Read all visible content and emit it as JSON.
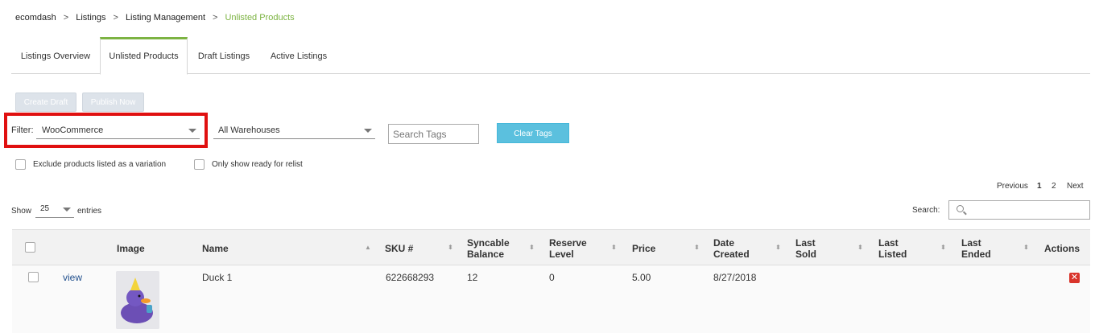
{
  "breadcrumb": {
    "items": [
      "ecomdash",
      "Listings",
      "Listing Management",
      "Unlisted Products"
    ],
    "separator": ">"
  },
  "tabs": [
    {
      "label": "Listings Overview",
      "active": false
    },
    {
      "label": "Unlisted Products",
      "active": true
    },
    {
      "label": "Draft Listings",
      "active": false
    },
    {
      "label": "Active Listings",
      "active": false
    }
  ],
  "actions": {
    "create_draft": "Create Draft",
    "publish_now": "Publish Now"
  },
  "filters": {
    "filter_label": "Filter:",
    "channel_value": "WooCommerce",
    "warehouse_value": "All Warehouses",
    "search_tags_placeholder": "Search Tags",
    "clear_tags": "Clear Tags",
    "exclude_variation_label": "Exclude products listed as a variation",
    "ready_relist_label": "Only show ready for relist"
  },
  "pagination": {
    "previous": "Previous",
    "page1": "1",
    "page2": "2",
    "next": "Next"
  },
  "table_controls": {
    "show_label": "Show",
    "entries_value": "25",
    "entries_label": "entries",
    "search_label": "Search:"
  },
  "table": {
    "headers": {
      "image": "Image",
      "name": "Name",
      "sku": "SKU #",
      "syncable_balance": "Syncable Balance",
      "reserve_level": "Reserve Level",
      "price": "Price",
      "date_created": "Date Created",
      "last_sold": "Last Sold",
      "last_listed": "Last Listed",
      "last_ended": "Last Ended",
      "actions": "Actions"
    },
    "rows": [
      {
        "view": "view",
        "name": "Duck 1",
        "sku": "622668293",
        "syncable_balance": "12",
        "reserve_level": "0",
        "price": "5.00",
        "date_created": "8/27/2018",
        "last_sold": "",
        "last_listed": "",
        "last_ended": ""
      }
    ]
  },
  "colors": {
    "accent_green": "#7cb342",
    "highlight_red": "#e01010",
    "clear_tags_blue": "#5bc0de",
    "delete_red": "#d9342b"
  }
}
